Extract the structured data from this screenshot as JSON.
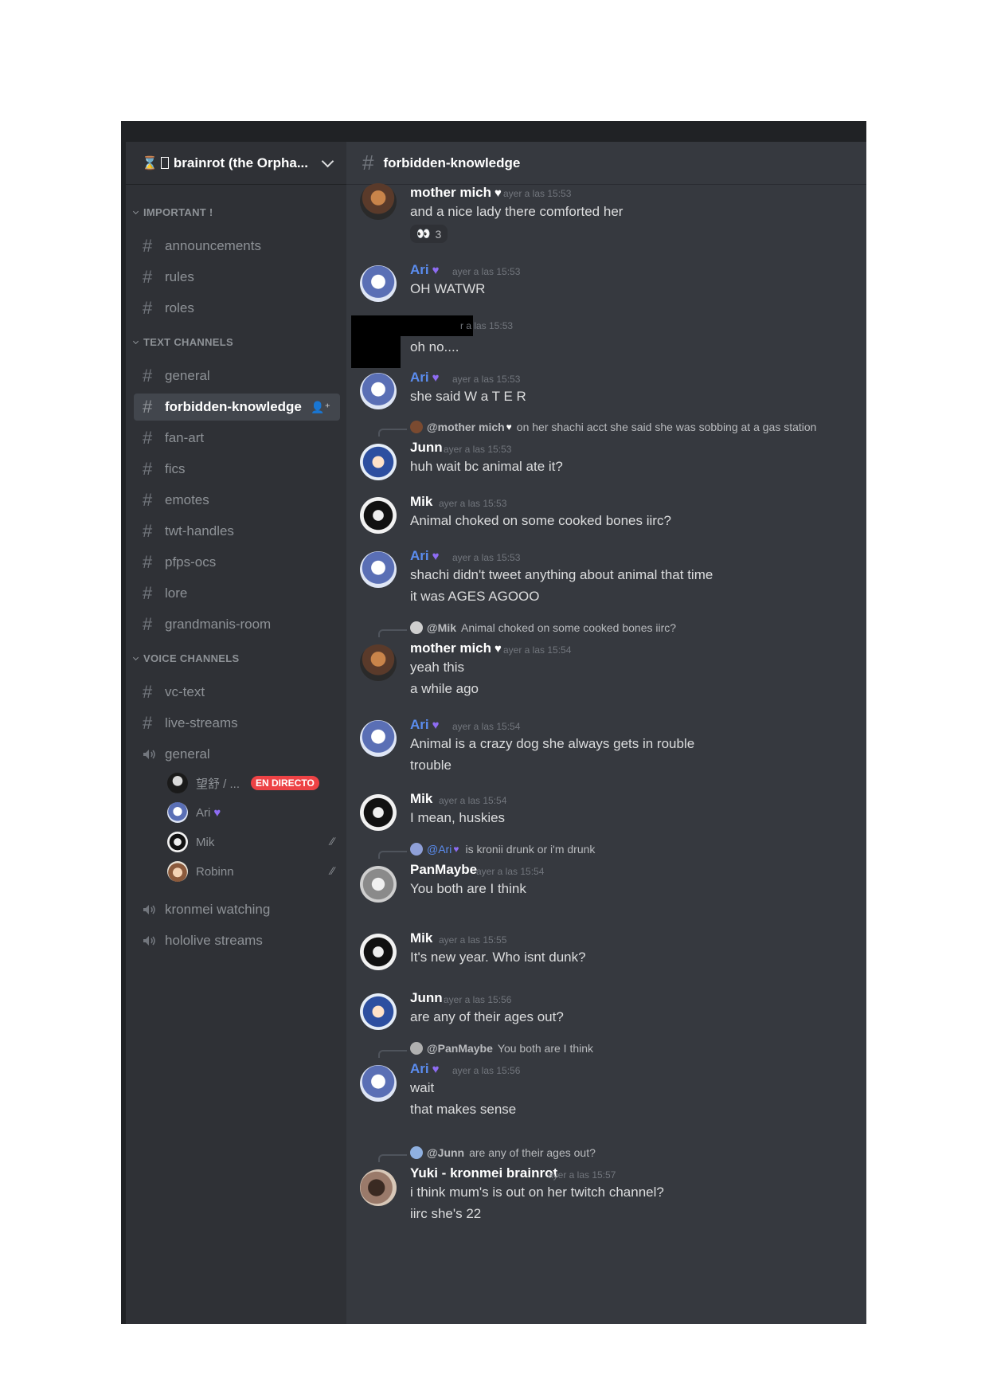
{
  "server": {
    "name": "brainrot (the Orpha...",
    "icon": "hourglass-icon"
  },
  "categories": {
    "important": "IMPORTANT !",
    "text": "TEXT CHANNELS",
    "voice": "VOICE CHANNELS"
  },
  "channels": {
    "announcements": "announcements",
    "rules": "rules",
    "roles": "roles",
    "general": "general",
    "forbidden": "forbidden-knowledge",
    "fanart": "fan-art",
    "fics": "fics",
    "emotes": "emotes",
    "twt": "twt-handles",
    "pfps": "pfps-ocs",
    "lore": "lore",
    "grandmanis": "grandmanis-room",
    "vctext": "vc-text",
    "livestreams": "live-streams",
    "vgeneral": "general",
    "kronmei": "kronmei watching",
    "hololive": "hololive streams"
  },
  "voice_users": {
    "u1": "望舒 / ...",
    "live_badge": "EN DIRECTO",
    "u2": "Ari",
    "u3": "Mik",
    "u4": "Robinn"
  },
  "header": {
    "channel": "forbidden-knowledge"
  },
  "messages": {
    "m1": {
      "author": "mother mich",
      "time": "ayer a las 15:53",
      "text": "and a nice lady there comforted her",
      "reaction": "3"
    },
    "m2": {
      "author": "Ari",
      "time": "ayer a las 15:53",
      "text": "OH WATWR"
    },
    "m3": {
      "time": "r a las 15:53",
      "text": "oh no...."
    },
    "m4": {
      "author": "Ari",
      "time": "ayer a las 15:53",
      "text": "she said W a T E R"
    },
    "m5": {
      "reply_user": "@mother mich",
      "reply_text": "on her shachi acct she said she was sobbing at a gas station",
      "author": "Junn",
      "time": "ayer a las 15:53",
      "text": "huh wait bc animal ate it?"
    },
    "m6": {
      "author": "Mik",
      "time": "ayer a las 15:53",
      "text": "Animal choked on some cooked bones iirc?"
    },
    "m7": {
      "author": "Ari",
      "time": "ayer a las 15:53",
      "text1": "shachi didn't tweet anything about animal that time",
      "text2": "it was AGES AGOOO"
    },
    "m8": {
      "reply_user": "@Mik",
      "reply_text": "Animal choked on some cooked bones iirc?",
      "author": "mother mich",
      "time": "ayer a las 15:54",
      "text1": "yeah this",
      "text2": "a while ago"
    },
    "m9": {
      "author": "Ari",
      "time": "ayer a las 15:54",
      "text1": "Animal is a crazy dog she always gets in rouble",
      "text2": "trouble"
    },
    "m10": {
      "author": "Mik",
      "time": "ayer a las 15:54",
      "text": "I mean, huskies"
    },
    "m11": {
      "reply_user": "@Ari",
      "reply_text": "is kronii drunk or i'm drunk",
      "author": "PanMaybe",
      "time": "ayer a las 15:54",
      "text": "You both are I think"
    },
    "m12": {
      "author": "Mik",
      "time": "ayer a las 15:55",
      "text": "It's new year. Who isnt dunk?"
    },
    "m13": {
      "author": "Junn",
      "time": "ayer a las 15:56",
      "text": "are any of their ages out?"
    },
    "m14": {
      "reply_user": "@PanMaybe",
      "reply_text": "You both are I think",
      "author": "Ari",
      "time": "ayer a las 15:56",
      "text1": "wait",
      "text2": "that makes sense"
    },
    "m15": {
      "reply_user": "@Junn",
      "reply_text": "are any of their ages out?",
      "author": "Yuki - kronmei brainrot",
      "time": "ayer a las 15:57",
      "text1": "i think mum's is out on her twitch channel?",
      "text2": "iirc she's 22"
    }
  },
  "colors": {
    "background": "#36393f",
    "sidebar": "#2f3136",
    "accent_blue": "#5b8df0",
    "heart_purple": "#8e6cf3",
    "live_red": "#ed4245"
  }
}
